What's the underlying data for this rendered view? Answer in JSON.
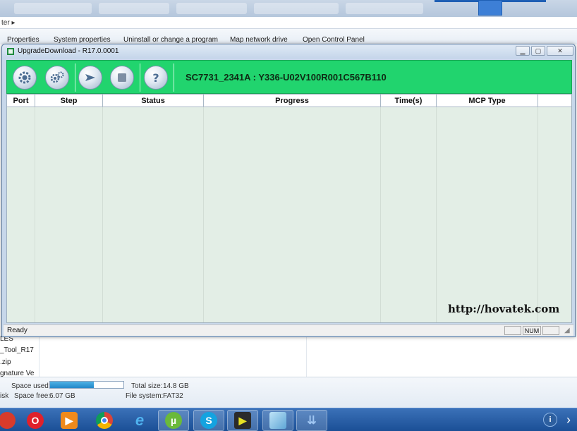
{
  "background": {
    "address_crumb": "ter",
    "command_bar": [
      "Properties",
      "System properties",
      "Uninstall or change a program",
      "Map network drive",
      "Open Control Panel"
    ],
    "left_items": [
      "LES",
      "_Tool_R17",
      ".zip",
      "gnature Ve"
    ],
    "details": {
      "space_used_label": "Space used:",
      "space_used_fraction": 0.6,
      "space_free_label": "Space free:",
      "space_free_value": "6.07 GB",
      "disk_label": "isk",
      "total_size_label": "Total size:",
      "total_size_value": "14.8 GB",
      "file_system_label": "File system:",
      "file_system_value": "FAT32"
    }
  },
  "app": {
    "title": "UpgradeDownload - R17.0.0001",
    "firmware_label": "SC7731_2341A : Y336-U02V100R001C567B110",
    "toolbar_buttons": [
      {
        "name": "settings-button",
        "icon": "gear-icon"
      },
      {
        "name": "options-button",
        "icon": "gears-icon"
      },
      {
        "name": "start-button",
        "icon": "play-icon"
      },
      {
        "name": "stop-button",
        "icon": "stop-icon"
      },
      {
        "name": "help-button",
        "icon": "help-icon"
      }
    ],
    "columns": [
      "Port",
      "Step",
      "Status",
      "Progress",
      "Time(s)",
      "MCP Type"
    ],
    "watermark": "http://hovatek.com",
    "status_text": "Ready",
    "status_panes": [
      "",
      "NUM",
      ""
    ],
    "accent_color": "#21d46e"
  },
  "taskbar": {
    "apps": [
      "opera-icon",
      "media-player-icon",
      "chrome-icon",
      "internet-explorer-icon",
      "utorrent-icon",
      "skype-icon",
      "app-icon",
      "explorer-icon",
      "upgrade-download-icon"
    ]
  }
}
